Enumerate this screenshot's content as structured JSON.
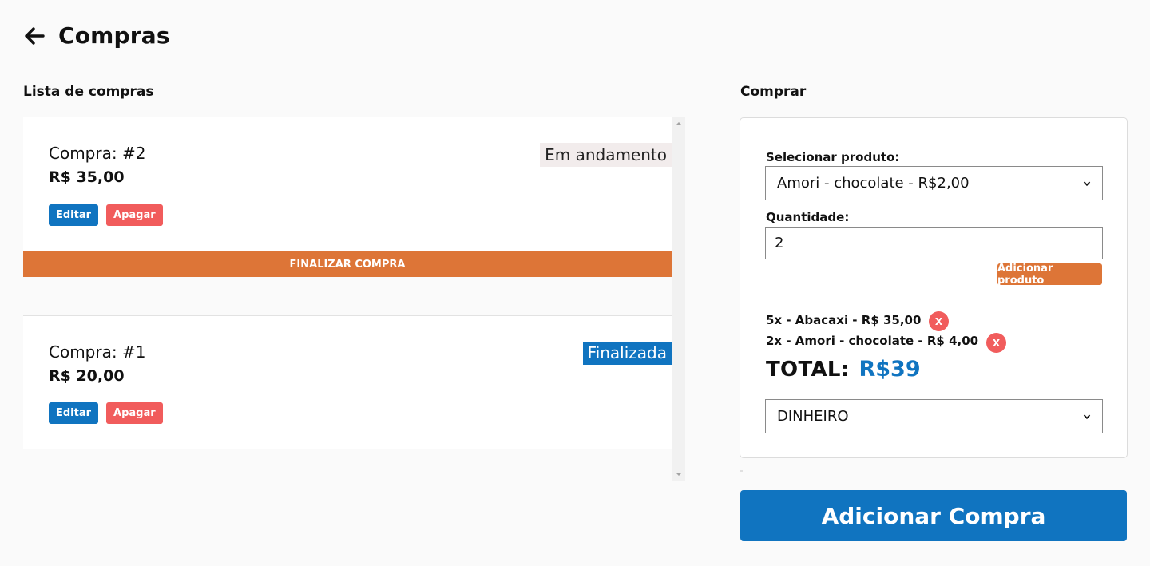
{
  "header": {
    "title": "Compras",
    "back_icon": "arrow-left-icon"
  },
  "list_section": {
    "title": "Lista de compras",
    "purchases": [
      {
        "id_label": "Compra: #2",
        "total": "R$ 35,00",
        "status": "Em andamento",
        "edit_label": "Editar",
        "delete_label": "Apagar",
        "finish_label": "FINALIZAR COMPRA"
      },
      {
        "id_label": "Compra: #1",
        "total": "R$ 20,00",
        "status": "Finalizada",
        "edit_label": "Editar",
        "delete_label": "Apagar"
      }
    ]
  },
  "buy_section": {
    "title": "Comprar",
    "product_label": "Selecionar produto:",
    "product_selected": "Amori - chocolate - R$2,00",
    "quantity_label": "Quantidade:",
    "quantity_value": "2",
    "add_product_label": "Adicionar produto",
    "cart_items": [
      {
        "text": "5x - Abacaxi - R$ 35,00",
        "remove_label": "X"
      },
      {
        "text": "2x - Amori - chocolate - R$ 4,00",
        "remove_label": "X"
      }
    ],
    "total_label": "TOTAL:",
    "total_value": "R$39",
    "payment_selected": "DINHEIRO"
  },
  "add_purchase_label": "Adicionar Compra",
  "colors": {
    "primary_blue": "#1074c0",
    "orange": "#dd7537",
    "red": "#f15c5c",
    "background": "#fafafa"
  }
}
